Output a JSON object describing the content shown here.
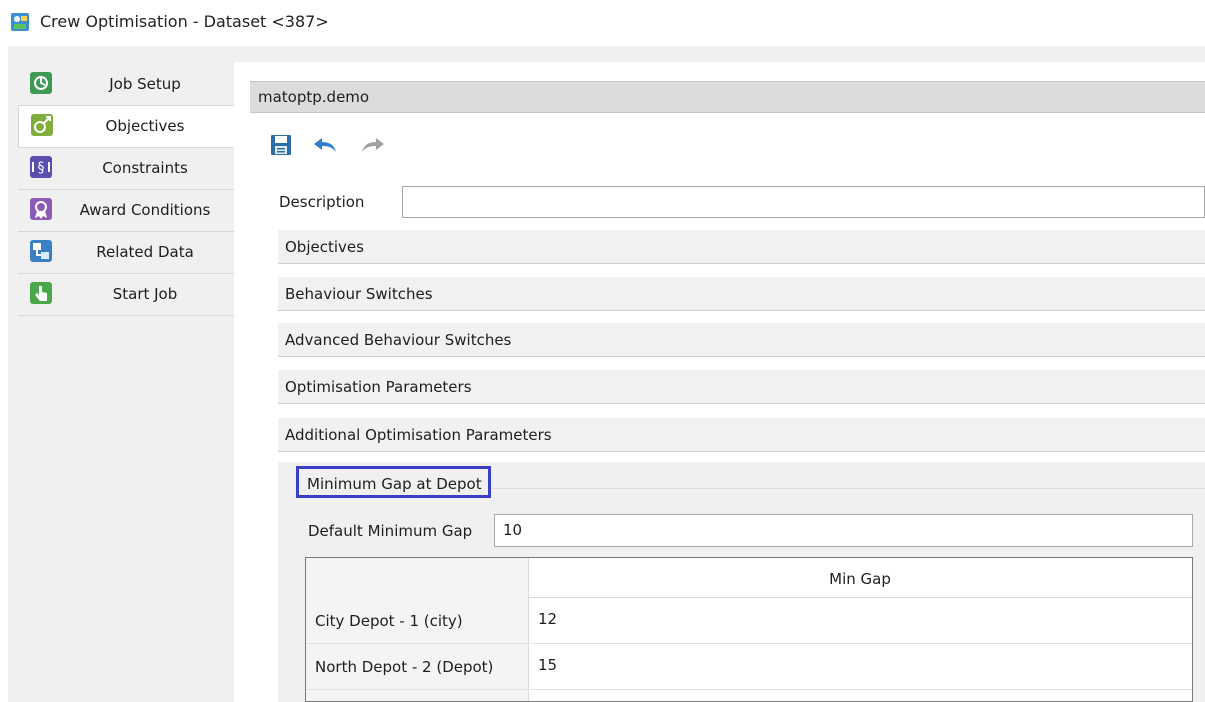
{
  "window": {
    "title": "Crew Optimisation - Dataset <387>"
  },
  "sidebar": {
    "items": [
      {
        "label": "Job Setup",
        "icon": "job-setup-icon",
        "active": false
      },
      {
        "label": "Objectives",
        "icon": "objectives-icon",
        "active": true
      },
      {
        "label": "Constraints",
        "icon": "constraints-icon",
        "active": false
      },
      {
        "label": "Award Conditions",
        "icon": "award-icon",
        "active": false
      },
      {
        "label": "Related Data",
        "icon": "related-data-icon",
        "active": false
      },
      {
        "label": "Start Job",
        "icon": "start-job-icon",
        "active": false
      }
    ]
  },
  "main": {
    "dataset_name": "matoptp.demo",
    "toolbar": {
      "save_icon": "save-icon",
      "undo_icon": "undo-icon",
      "redo_icon": "redo-icon"
    },
    "description": {
      "label": "Description",
      "value": ""
    },
    "sections": [
      "Objectives",
      "Behaviour Switches",
      "Advanced Behaviour Switches",
      "Optimisation Parameters",
      "Additional Optimisation Parameters"
    ],
    "min_gap": {
      "group_title": "Minimum Gap at Depot",
      "default_label": "Default Minimum Gap",
      "default_value": "10",
      "column_header": "Min Gap",
      "rows": [
        {
          "depot": "City Depot - 1 (city)",
          "value": "12"
        },
        {
          "depot": "North Depot - 2 (Depot)",
          "value": "15"
        }
      ]
    }
  },
  "colors": {
    "highlight_border": "#3b3fc4",
    "undo_blue": "#2f7fd0",
    "redo_gray": "#a0a0a0"
  }
}
